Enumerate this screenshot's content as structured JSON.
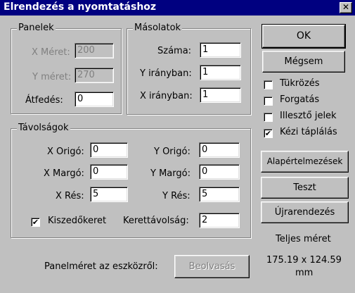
{
  "window": {
    "title": "Elrendezés a nyomtatáshoz",
    "close_glyph": "✕"
  },
  "panelek": {
    "legend": "Panelek",
    "x_meret_label": "X Méret:",
    "x_meret_value": "200",
    "y_meret_label": "Y méret:",
    "y_meret_value": "270",
    "atfedes_label": "Átfedés:",
    "atfedes_value": "0"
  },
  "masolatok": {
    "legend": "Másolatok",
    "szama_label": "Száma:",
    "szama_value": "1",
    "y_iranyban_label": "Y irányban:",
    "y_iranyban_value": "1",
    "x_iranyban_label": "X irányban:",
    "x_iranyban_value": "1"
  },
  "tavolsagok": {
    "legend": "Távolságok",
    "x_origo_label": "X Origó:",
    "x_origo_value": "0",
    "y_origo_label": "Y Origó:",
    "y_origo_value": "0",
    "x_margo_label": "X Margó:",
    "x_margo_value": "0",
    "y_margo_label": "Y Margó:",
    "y_margo_value": "0",
    "x_res_label": "X Rés:",
    "x_res_value": "5",
    "y_res_label": "Y Rés:",
    "y_res_value": "5",
    "kiszedokeret_label": "Kiszedőkeret",
    "kiszedokeret_checked": true,
    "kerettavolsag_label": "Kerettávolság:",
    "kerettavolsag_value": "2"
  },
  "buttons": {
    "ok": "OK",
    "megsem": "Mégsem",
    "alapertelmezesek": "Alapértelmezések",
    "teszt": "Teszt",
    "ujrarendezes": "Újrarendezés",
    "beolvasas": "Beolvasás"
  },
  "options": [
    {
      "label": "Tükrözés",
      "checked": false
    },
    {
      "label": "Forgatás",
      "checked": false
    },
    {
      "label": "Illesztő jelek",
      "checked": false
    },
    {
      "label": "Kézi táplálás",
      "checked": true
    }
  ],
  "teljes_meret": {
    "label": "Teljes méret",
    "value": "175.19 x 124.59",
    "unit": "mm"
  },
  "panelmeret_label": "Panelméret az eszközről:",
  "check_glyph": "✔"
}
